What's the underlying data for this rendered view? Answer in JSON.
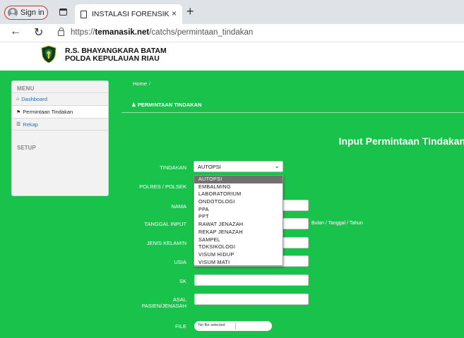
{
  "browser": {
    "profile_label": "Sign in",
    "tab_title": "INSTALASI FORENSIK R.S. BHAYANGKARA",
    "tab_close": "×",
    "new_tab": "+",
    "url_prefix": "https://",
    "url_domain": "temanasik.net",
    "url_path": "/catchs/permintaan_tindakan"
  },
  "header": {
    "line1": "R.S. BHAYANGKARA BATAM",
    "line2": "POLDA KEPULAUAN RIAU"
  },
  "sidebar": {
    "menu_heading": "MENU",
    "items": [
      {
        "label": "Dashboard",
        "icon": "home-icon"
      },
      {
        "label": "Permintaan Tindakan",
        "icon": "tag-icon"
      },
      {
        "label": "Rekap",
        "icon": "list-icon"
      }
    ],
    "setup_heading": "SETUP"
  },
  "content": {
    "breadcrumb_home": "Home",
    "breadcrumb_sep": "/",
    "section_title": "PERMINTAAN TINDAKAN",
    "heading": "Input Permintaan Tindakan",
    "form": {
      "tindakan_label": "TINDAKAN",
      "tindakan_value": "AUTOPSI",
      "polres_label": "POLRES / POLSEK",
      "nama_label": "NAMA",
      "tanggal_label": "TANGGAL INPUT",
      "tanggal_hint": "Bulan / Tanggal / Tahun",
      "jenis_kelamin_label": "JENIS KELAMIN",
      "usia_label": "USIA",
      "sk_label": "SK",
      "asal_label_1": "ASAL",
      "asal_label_2": "PASIEN/JENASAH",
      "file_label": "FILE",
      "file_status": "No file selected"
    },
    "dropdown_options": [
      "AUTOPSI",
      "EMBALMING",
      "LABORATORIUM",
      "ONDOTOLOGI",
      "PPA",
      "PPT",
      "RAWAT JENAZAH",
      "REKAP JENAZAH",
      "SAMPEL",
      "TOKSIKOLOGI",
      "VISUM HIDUP",
      "VISUM MATI"
    ]
  },
  "colors": {
    "green": "#19c24a",
    "selected_option": "#707070",
    "link": "#2b6ea8"
  }
}
